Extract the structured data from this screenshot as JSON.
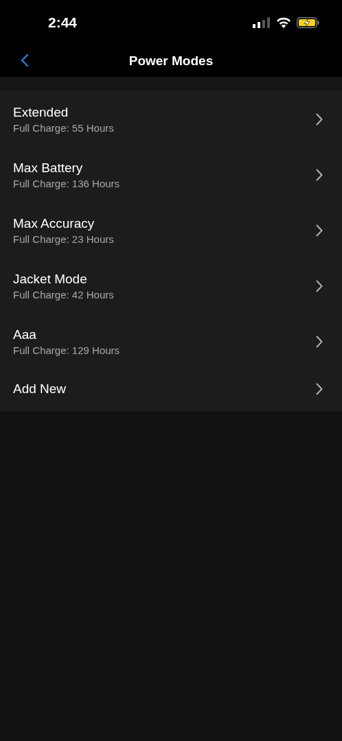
{
  "status_bar": {
    "time": "2:44"
  },
  "nav": {
    "title": "Power Modes"
  },
  "modes": [
    {
      "kind": "mode",
      "name": "Extended",
      "detail": "Full Charge: 55 Hours"
    },
    {
      "kind": "mode",
      "name": "Max Battery",
      "detail": "Full Charge: 136 Hours"
    },
    {
      "kind": "mode",
      "name": "Max Accuracy",
      "detail": "Full Charge: 23 Hours"
    },
    {
      "kind": "mode",
      "name": "Jacket Mode",
      "detail": "Full Charge: 42 Hours"
    },
    {
      "kind": "mode",
      "name": "Aaa",
      "detail": "Full Charge: 129 Hours"
    },
    {
      "kind": "add",
      "name": "Add New"
    }
  ]
}
